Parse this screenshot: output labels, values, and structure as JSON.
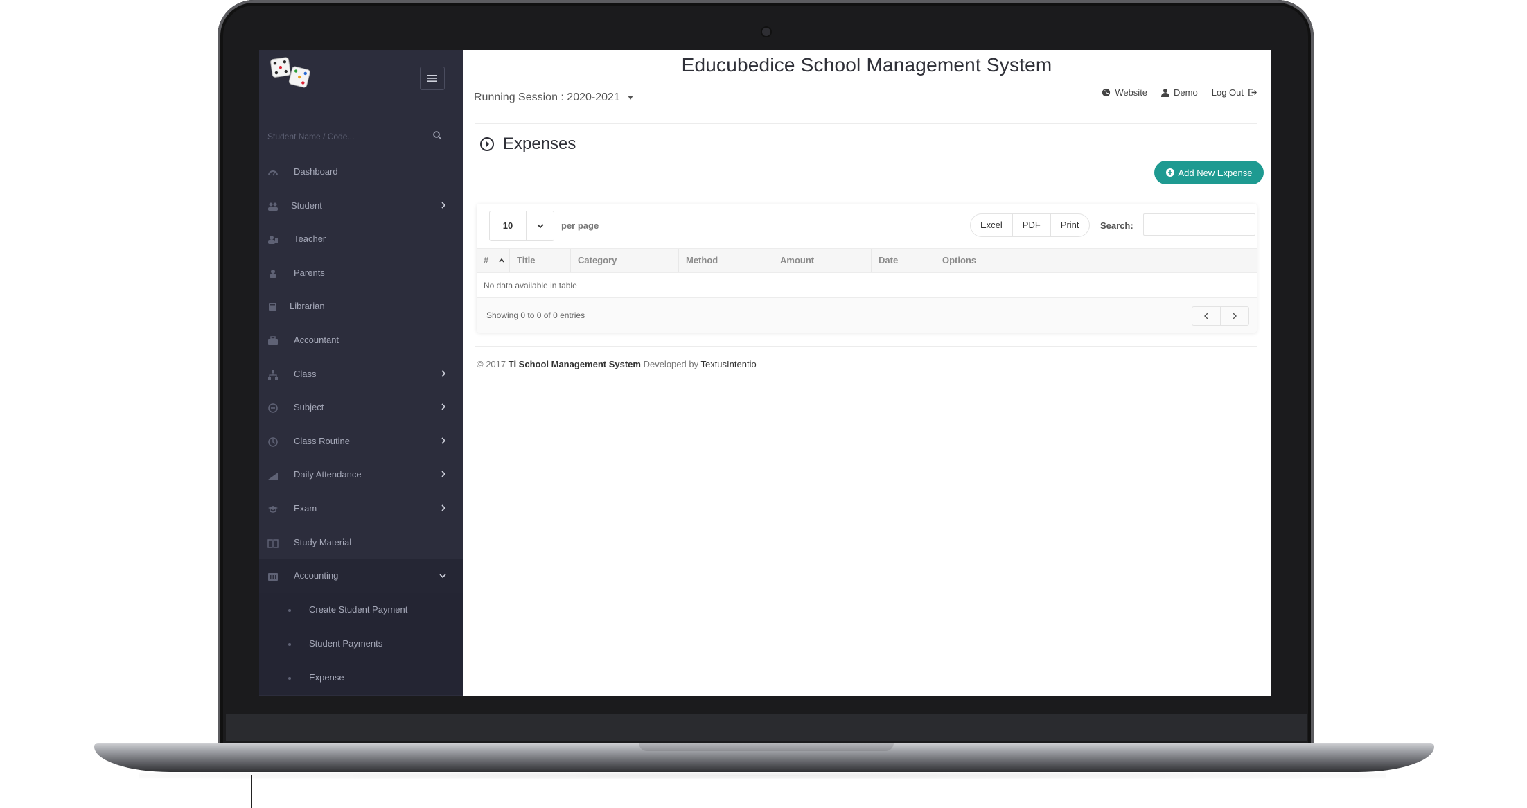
{
  "app": {
    "title": "Educubedice School Management System",
    "session_label": "Running Session : 2020-2021"
  },
  "header": {
    "links": [
      "Website",
      "Demo",
      "Log Out"
    ]
  },
  "sidebar": {
    "search_placeholder": "Student Name / Code...",
    "items": [
      {
        "label": "Dashboard",
        "icon": "dashboard-icon",
        "has_children": false
      },
      {
        "label": "Student",
        "icon": "users-icon",
        "has_children": true
      },
      {
        "label": "Teacher",
        "icon": "teacher-icon",
        "has_children": false
      },
      {
        "label": "Parents",
        "icon": "user-icon",
        "has_children": false
      },
      {
        "label": "Librarian",
        "icon": "book-icon",
        "has_children": false
      },
      {
        "label": "Accountant",
        "icon": "briefcase-icon",
        "has_children": false
      },
      {
        "label": "Class",
        "icon": "sitemap-icon",
        "has_children": true
      },
      {
        "label": "Subject",
        "icon": "subject-icon",
        "has_children": true
      },
      {
        "label": "Class Routine",
        "icon": "clock-icon",
        "has_children": true
      },
      {
        "label": "Daily Attendance",
        "icon": "chart-icon",
        "has_children": true
      },
      {
        "label": "Exam",
        "icon": "graduation-cap-icon",
        "has_children": true
      },
      {
        "label": "Study Material",
        "icon": "open-book-icon",
        "has_children": false
      },
      {
        "label": "Accounting",
        "icon": "accounting-icon",
        "has_children": true,
        "open": true
      }
    ],
    "accounting_children": [
      "Create Student Payment",
      "Student Payments",
      "Expense"
    ]
  },
  "page": {
    "heading": "Expenses",
    "add_button": "Add New Expense"
  },
  "table": {
    "per_page_value": "10",
    "per_page_label": "per page",
    "export_buttons": [
      "Excel",
      "PDF",
      "Print"
    ],
    "search_label": "Search:",
    "columns": [
      "#",
      "Title",
      "Category",
      "Method",
      "Amount",
      "Date",
      "Options"
    ],
    "empty_message": "No data available in table",
    "info": "Showing 0 to 0 of 0 entries"
  },
  "footer": {
    "prefix": "© 2017",
    "product": "Ti School Management System",
    "middle": "Developed by",
    "developer": "TextusIntentio"
  },
  "colors": {
    "sidebar_bg": "#2c2d3c",
    "accent": "#1e9a91"
  }
}
